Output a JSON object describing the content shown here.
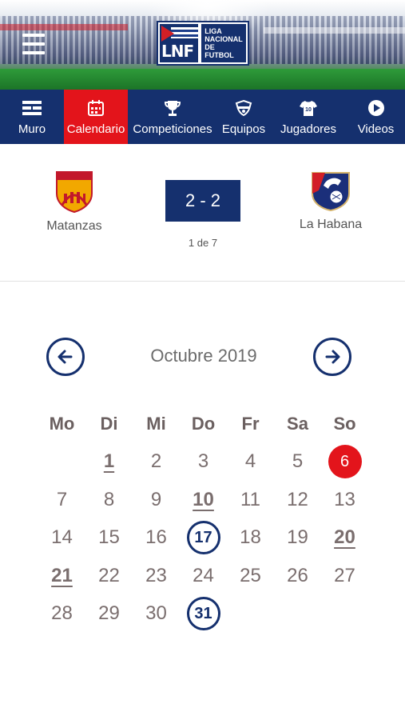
{
  "header": {
    "logo": {
      "abbr": "LNF",
      "text_lines": [
        "LIGA",
        "NACIONAL",
        "DE FUTBOL"
      ]
    },
    "menu_icon": "hamburger-icon"
  },
  "nav": {
    "items": [
      {
        "label": "Muro",
        "icon": "wall-icon",
        "active": false
      },
      {
        "label": "Calendario",
        "icon": "calendar-icon",
        "active": true
      },
      {
        "label": "Competiciones",
        "icon": "trophy-icon",
        "active": false
      },
      {
        "label": "Equipos",
        "icon": "team-icon",
        "active": false
      },
      {
        "label": "Jugadores",
        "icon": "jersey-icon",
        "active": false
      },
      {
        "label": "Videos",
        "icon": "play-icon",
        "active": false
      }
    ],
    "active_color": "#e3141b",
    "bg_color": "#15306e"
  },
  "match": {
    "home": {
      "name": "Matanzas",
      "crest_text": "MATANZAS"
    },
    "away": {
      "name": "La Habana"
    },
    "score": "2 - 2",
    "pager": "1 de 7"
  },
  "calendar": {
    "title": "Octubre 2019",
    "prev_icon": "arrow-left-icon",
    "next_icon": "arrow-right-icon",
    "weekdays": [
      "Mo",
      "Di",
      "Mi",
      "Do",
      "Fr",
      "Sa",
      "So"
    ],
    "weeks": [
      [
        null,
        "1",
        "2",
        "3",
        "4",
        "5",
        "6"
      ],
      [
        "7",
        "8",
        "9",
        "10",
        "11",
        "12",
        "13"
      ],
      [
        "14",
        "15",
        "16",
        "17",
        "18",
        "19",
        "20"
      ],
      [
        "21",
        "22",
        "23",
        "24",
        "25",
        "26",
        "27"
      ],
      [
        "28",
        "29",
        "30",
        "31",
        null,
        null,
        null
      ]
    ],
    "underlined_days": [
      "1",
      "10",
      "20",
      "21"
    ],
    "circled_days": [
      "17",
      "31"
    ],
    "today": "6"
  }
}
